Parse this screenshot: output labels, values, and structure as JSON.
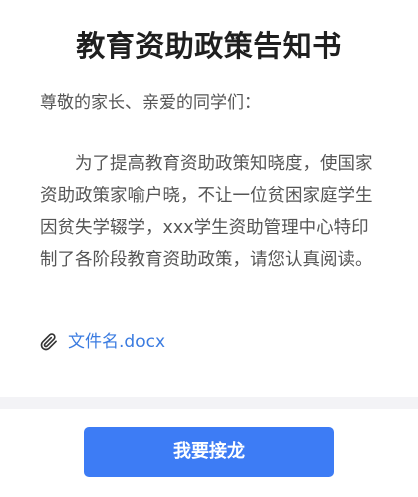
{
  "page": {
    "title": "教育资助政策告知书",
    "greeting": "尊敬的家长、亲爱的同学们：",
    "body": "为了提高教育资助政策知晓度，使国家资助政策家喻户晓，不让一位贫困家庭学生因贫失学辍学，xxx学生资助管理中心特印制了各阶段教育资助政策，请您认真阅读。"
  },
  "attachment": {
    "icon": "paperclip-icon",
    "filename": "文件名.docx",
    "color": "#3a7be0"
  },
  "footer": {
    "button_label": "我要接龙",
    "button_color": "#3d7cf5"
  }
}
